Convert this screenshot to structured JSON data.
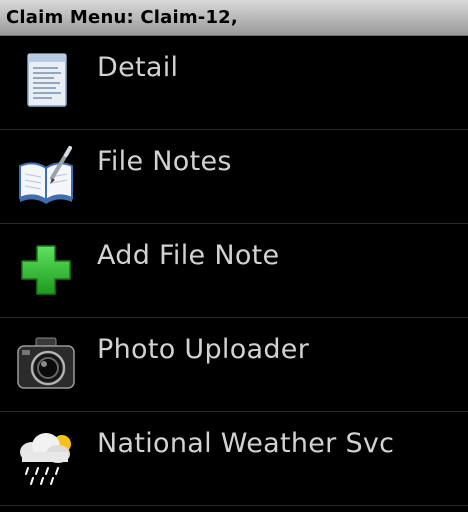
{
  "window": {
    "title": "Claim Menu: Claim-12,"
  },
  "menu": {
    "items": [
      {
        "label": "Detail",
        "icon": "document-icon"
      },
      {
        "label": "File Notes",
        "icon": "open-book-pen-icon"
      },
      {
        "label": "Add File Note",
        "icon": "green-plus-icon"
      },
      {
        "label": "Photo Uploader",
        "icon": "camera-icon"
      },
      {
        "label": "National Weather Svc",
        "icon": "rain-cloud-icon"
      }
    ]
  },
  "colors": {
    "background": "#000000",
    "label_text": "#d2d2d2",
    "plus_green": "#2fb52f"
  }
}
